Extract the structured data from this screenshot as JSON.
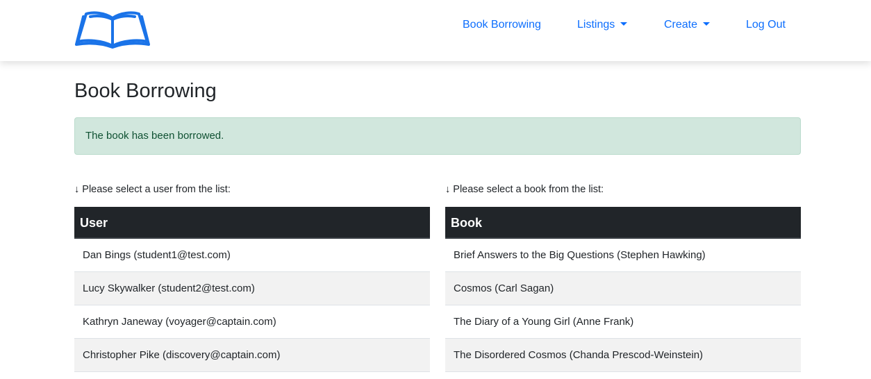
{
  "nav": {
    "links": [
      {
        "label": "Book Borrowing",
        "dropdown": false
      },
      {
        "label": "Listings",
        "dropdown": true
      },
      {
        "label": "Create",
        "dropdown": true
      },
      {
        "label": "Log Out",
        "dropdown": false
      }
    ],
    "link_color": "#0d6efd",
    "logo_icon": "open-book-icon"
  },
  "page": {
    "title": "Book Borrowing"
  },
  "alert": {
    "message": "The book has been borrowed.",
    "variant": "success",
    "bg_color": "#d1e7dd",
    "text_color": "#0f5132"
  },
  "users": {
    "hint": "↓ Please select a user from the list:",
    "header": "User",
    "rows": [
      "Dan Bings (student1@test.com)",
      "Lucy Skywalker (student2@test.com)",
      "Kathryn Janeway (voyager@captain.com)",
      "Christopher Pike (discovery@captain.com)"
    ]
  },
  "books": {
    "hint": "↓ Please select a book from the list:",
    "header": "Book",
    "rows": [
      "Brief Answers to the Big Questions (Stephen Hawking)",
      "Cosmos (Carl Sagan)",
      "The Diary of a Young Girl (Anne Frank)",
      "The Disordered Cosmos (Chanda Prescod-Weinstein)"
    ]
  }
}
